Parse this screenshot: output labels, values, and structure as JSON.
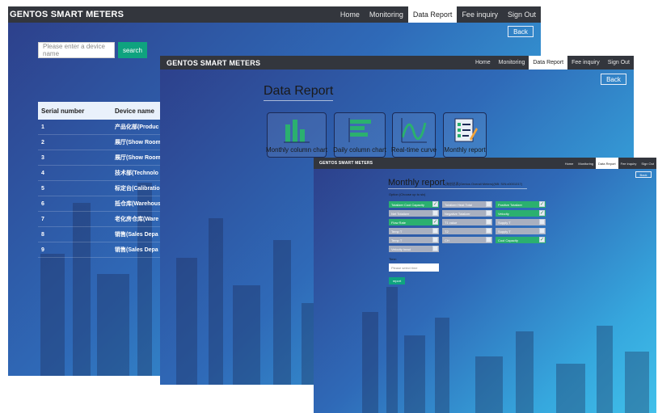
{
  "colors": {
    "topbar": "#33363d",
    "accent_green": "#0fa37f",
    "option_on": "#2bb06f",
    "option_off": "#a9b0c0"
  },
  "main_window": {
    "brand": "GENTOS SMART METERS",
    "nav": [
      {
        "label": "Home"
      },
      {
        "label": "Monitoring"
      },
      {
        "label": "Data Report",
        "active": true
      },
      {
        "label": "Fee inquiry"
      },
      {
        "label": "Sign Out"
      }
    ],
    "back_label": "Back",
    "search": {
      "placeholder": "Please enter a device name",
      "button_label": "search"
    },
    "table": {
      "headers": [
        "Serial number",
        "Device name"
      ],
      "rows": [
        {
          "serial": "1",
          "name": "产品化部(Produc"
        },
        {
          "serial": "2",
          "name": "展厅(Show Room"
        },
        {
          "serial": "3",
          "name": "展厅(Show Room"
        },
        {
          "serial": "4",
          "name": "技术部(Technolo"
        },
        {
          "serial": "5",
          "name": "标定台(Calibratio"
        },
        {
          "serial": "6",
          "name": "抵仓库(Warehous"
        },
        {
          "serial": "7",
          "name": "老化房仓库(Ware"
        },
        {
          "serial": "8",
          "name": "销售(Sales Depa"
        },
        {
          "serial": "9",
          "name": "销售(Sales Depa"
        }
      ]
    }
  },
  "data_report_window": {
    "brand": "GENTOS SMART METERS",
    "nav": [
      {
        "label": "Home"
      },
      {
        "label": "Monitoring"
      },
      {
        "label": "Data Report",
        "active": true
      },
      {
        "label": "Fee inquiry"
      },
      {
        "label": "Sign Out"
      }
    ],
    "back_label": "Back",
    "title": "Data Report",
    "tiles": [
      {
        "label": "Monthly column chart",
        "icon": "column-chart-icon"
      },
      {
        "label": "Daily column chart",
        "icon": "bar-chart-icon"
      },
      {
        "label": "Real-time curve",
        "icon": "curve-chart-icon"
      },
      {
        "label": "Monthly report",
        "icon": "report-icon"
      }
    ]
  },
  "monthly_report_window": {
    "brand": "GENTOS SMART METERS",
    "nav": [
      {
        "label": "Home"
      },
      {
        "label": "Monitoring"
      },
      {
        "label": "Data Report",
        "active": true
      },
      {
        "label": "Fee inquiry"
      },
      {
        "label": "Sign Out"
      }
    ],
    "back_label": "Back",
    "title": "Monthly report",
    "subtitle": "(海创总表(Gentos Overall Meters)(NB: S/N:x0001017)",
    "option_hint": "Option  (Choose up to six)",
    "options": [
      [
        {
          "label": "Totalizer Cool Capacity",
          "checked": true
        },
        {
          "label": "Net Totalizer",
          "checked": false
        },
        {
          "label": "Flow Rate",
          "checked": true
        },
        {
          "label": "Temp T",
          "checked": false
        },
        {
          "label": "Temp T",
          "checked": false
        },
        {
          "label": "Velocity head",
          "checked": false
        }
      ],
      [
        {
          "label": "Totalizer Heat Total",
          "checked": false
        },
        {
          "label": "Negative Totalizer",
          "checked": false
        },
        {
          "label": "T1 value",
          "checked": false
        },
        {
          "label": "T2",
          "checked": false
        },
        {
          "label": "CH",
          "checked": false
        }
      ],
      [
        {
          "label": "Positive Totalizer",
          "checked": true
        },
        {
          "label": "Velocity",
          "checked": true
        },
        {
          "label": "Supply T",
          "checked": false
        },
        {
          "label": "Supply T",
          "checked": false
        },
        {
          "label": "Cool Capacity",
          "checked": true
        }
      ]
    ],
    "time_label": "Time:",
    "time_placeholder": "Please select time",
    "report_button": "report"
  }
}
